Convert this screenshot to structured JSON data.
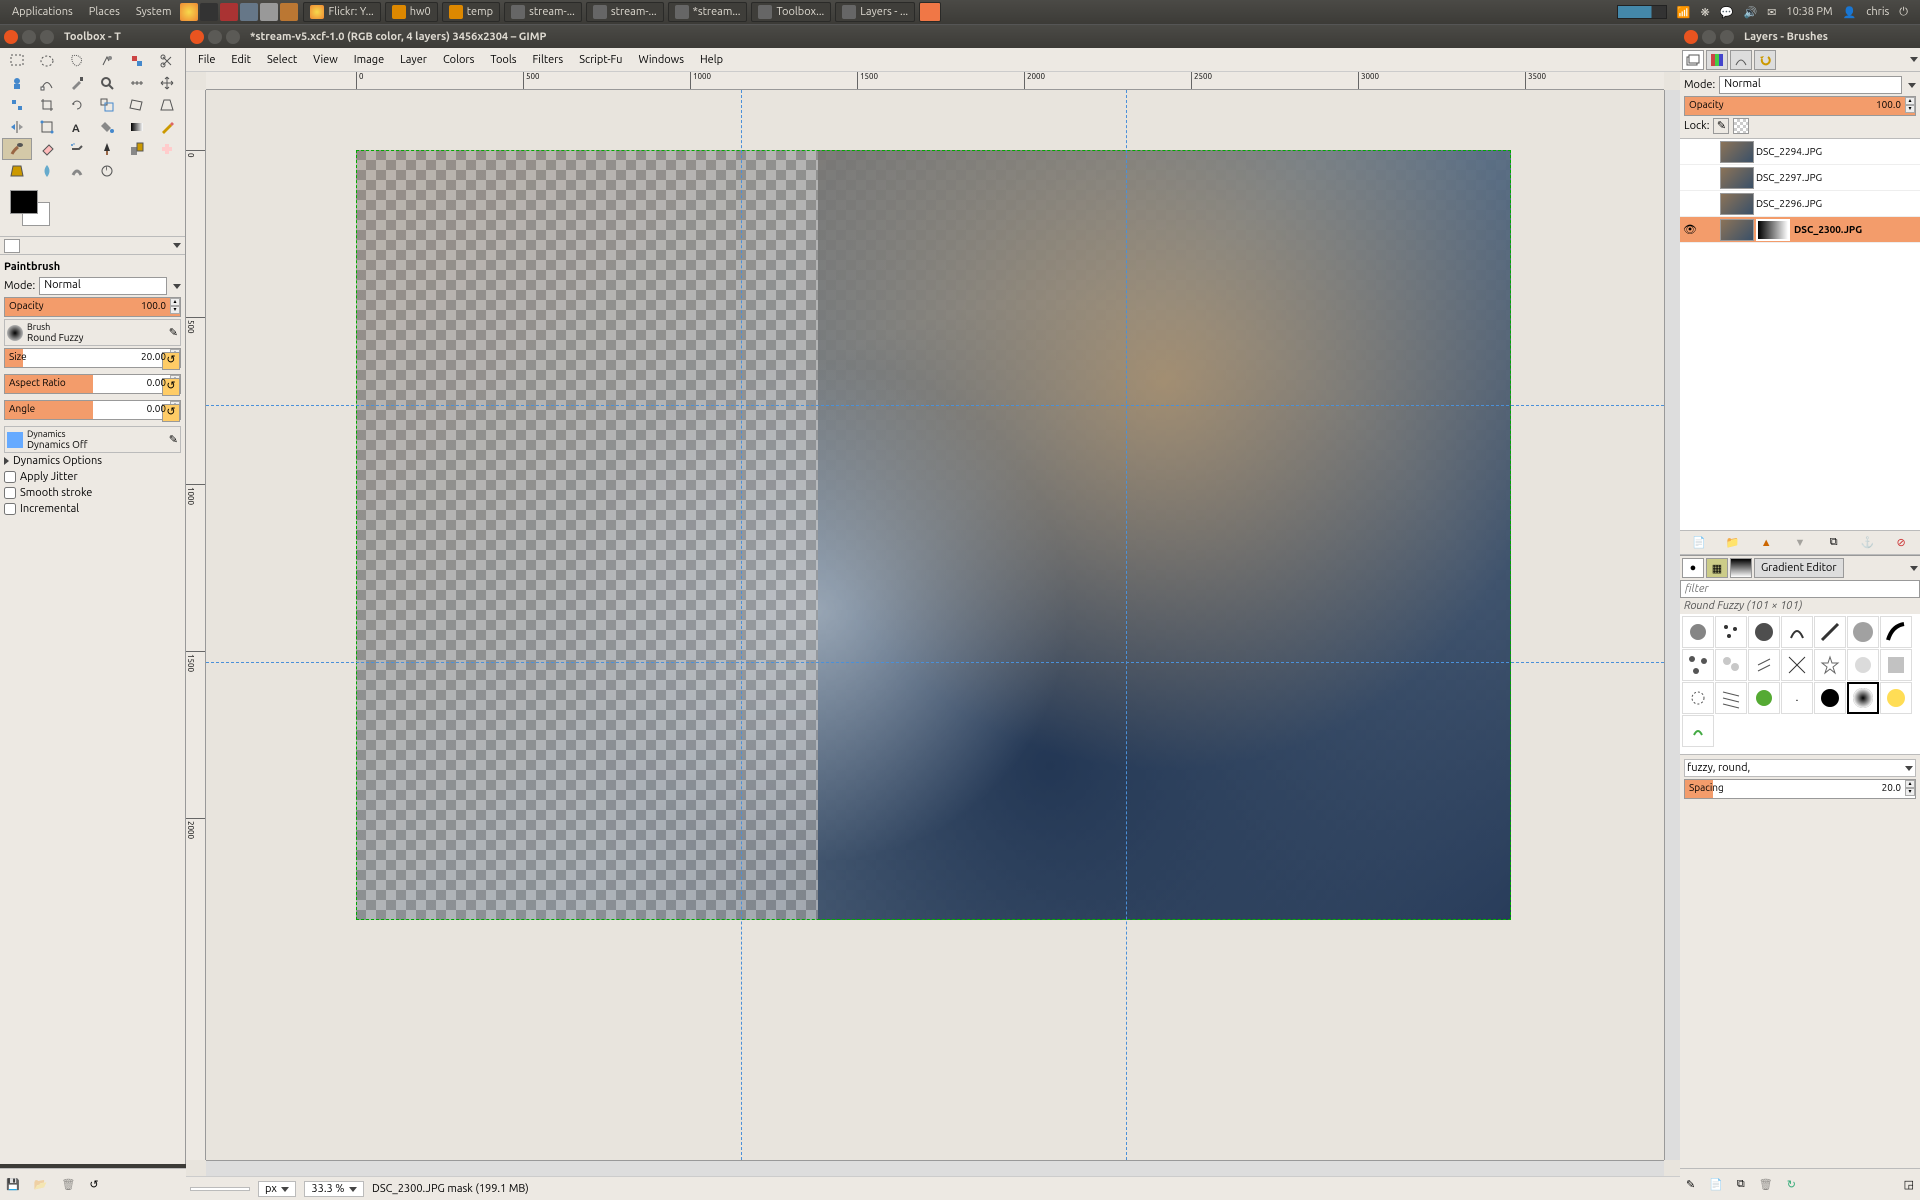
{
  "topbar": {
    "menus": [
      "Applications",
      "Places",
      "System"
    ],
    "tasks": [
      {
        "label": "Flickr: Y..."
      },
      {
        "label": "hw0"
      },
      {
        "label": "temp"
      },
      {
        "label": "stream-..."
      },
      {
        "label": "stream-..."
      },
      {
        "label": "*stream..."
      },
      {
        "label": "Toolbox..."
      },
      {
        "label": "Layers - ..."
      }
    ],
    "time": "10:38 PM",
    "user": "chris"
  },
  "toolbox_win": {
    "title": "Toolbox - T"
  },
  "image_win": {
    "title": "*stream-v5.xcf-1.0 (RGB color, 4 layers) 3456x2304 – GIMP",
    "menus": [
      "File",
      "Edit",
      "Select",
      "View",
      "Image",
      "Layer",
      "Colors",
      "Tools",
      "Filters",
      "Script-Fu",
      "Windows",
      "Help"
    ],
    "ruler_ticks_h": [
      "0",
      "500",
      "1000",
      "1500",
      "2000",
      "2500",
      "3000",
      "3500"
    ],
    "zoom": "33.3 %",
    "unit": "px",
    "status": "DSC_2300.JPG mask (199.1 MB)"
  },
  "layers_win": {
    "title": "Layers - Brushes",
    "mode_label": "Mode:",
    "mode_value": "Normal",
    "opacity_label": "Opacity",
    "opacity_value": "100.0",
    "lock_label": "Lock:",
    "layers": [
      {
        "name": "DSC_2294.JPG",
        "visible": false,
        "selected": false
      },
      {
        "name": "DSC_2297.JPG",
        "visible": false,
        "selected": false
      },
      {
        "name": "DSC_2296.JPG",
        "visible": false,
        "selected": false
      },
      {
        "name": "DSC_2300.JPG",
        "visible": true,
        "selected": true
      }
    ],
    "gradient_editor_label": "Gradient Editor",
    "brush_filter_placeholder": "filter",
    "brush_info": "Round Fuzzy (101 × 101)",
    "brush_tags": "fuzzy, round,",
    "spacing_label": "Spacing",
    "spacing_value": "20.0"
  },
  "tool_options": {
    "tool_name": "Paintbrush",
    "mode_label": "Mode:",
    "mode_value": "Normal",
    "opacity_label": "Opacity",
    "opacity_value": "100.0",
    "brush_label": "Brush",
    "brush_value": "Round Fuzzy",
    "size_label": "Size",
    "size_value": "20.00",
    "aspect_label": "Aspect Ratio",
    "aspect_value": "0.00",
    "angle_label": "Angle",
    "angle_value": "0.00",
    "dynamics_label": "Dynamics",
    "dynamics_value": "Dynamics Off",
    "dynamics_options": "Dynamics Options",
    "jitter": "Apply Jitter",
    "smooth": "Smooth stroke",
    "incremental": "Incremental"
  }
}
